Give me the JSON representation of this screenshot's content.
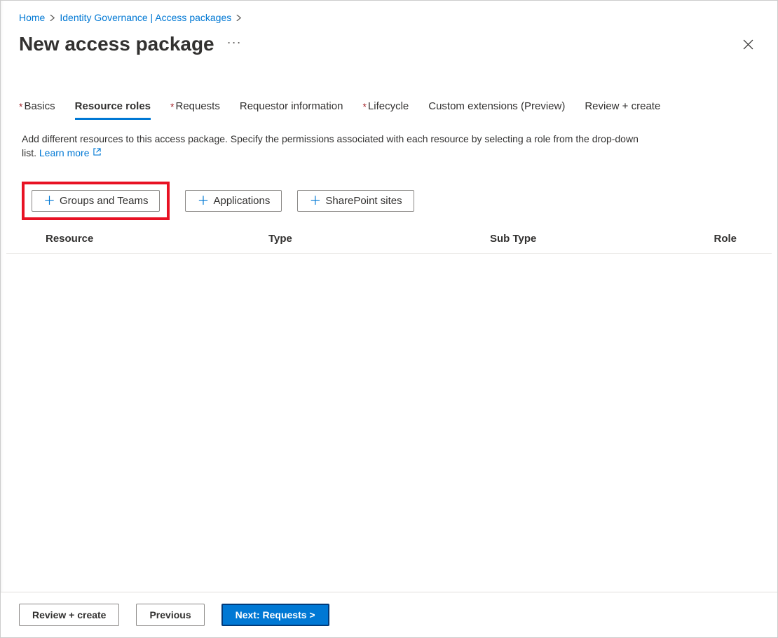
{
  "breadcrumb": {
    "home": "Home",
    "path": "Identity Governance | Access packages"
  },
  "page": {
    "title": "New access package"
  },
  "tabs": [
    {
      "label": "Basics",
      "required": true,
      "active": false
    },
    {
      "label": "Resource roles",
      "required": false,
      "active": true
    },
    {
      "label": "Requests",
      "required": true,
      "active": false
    },
    {
      "label": "Requestor information",
      "required": false,
      "active": false
    },
    {
      "label": "Lifecycle",
      "required": true,
      "active": false
    },
    {
      "label": "Custom extensions (Preview)",
      "required": false,
      "active": false
    },
    {
      "label": "Review + create",
      "required": false,
      "active": false
    }
  ],
  "description": {
    "text": "Add different resources to this access package. Specify the permissions associated with each resource by selecting a role from the drop-down list.",
    "learnmore": "Learn more"
  },
  "addButtons": {
    "groups": "Groups and Teams",
    "applications": "Applications",
    "sharepoint": "SharePoint sites"
  },
  "tableHeaders": {
    "resource": "Resource",
    "type": "Type",
    "subtype": "Sub Type",
    "role": "Role"
  },
  "footer": {
    "review": "Review + create",
    "previous": "Previous",
    "next": "Next: Requests >"
  }
}
